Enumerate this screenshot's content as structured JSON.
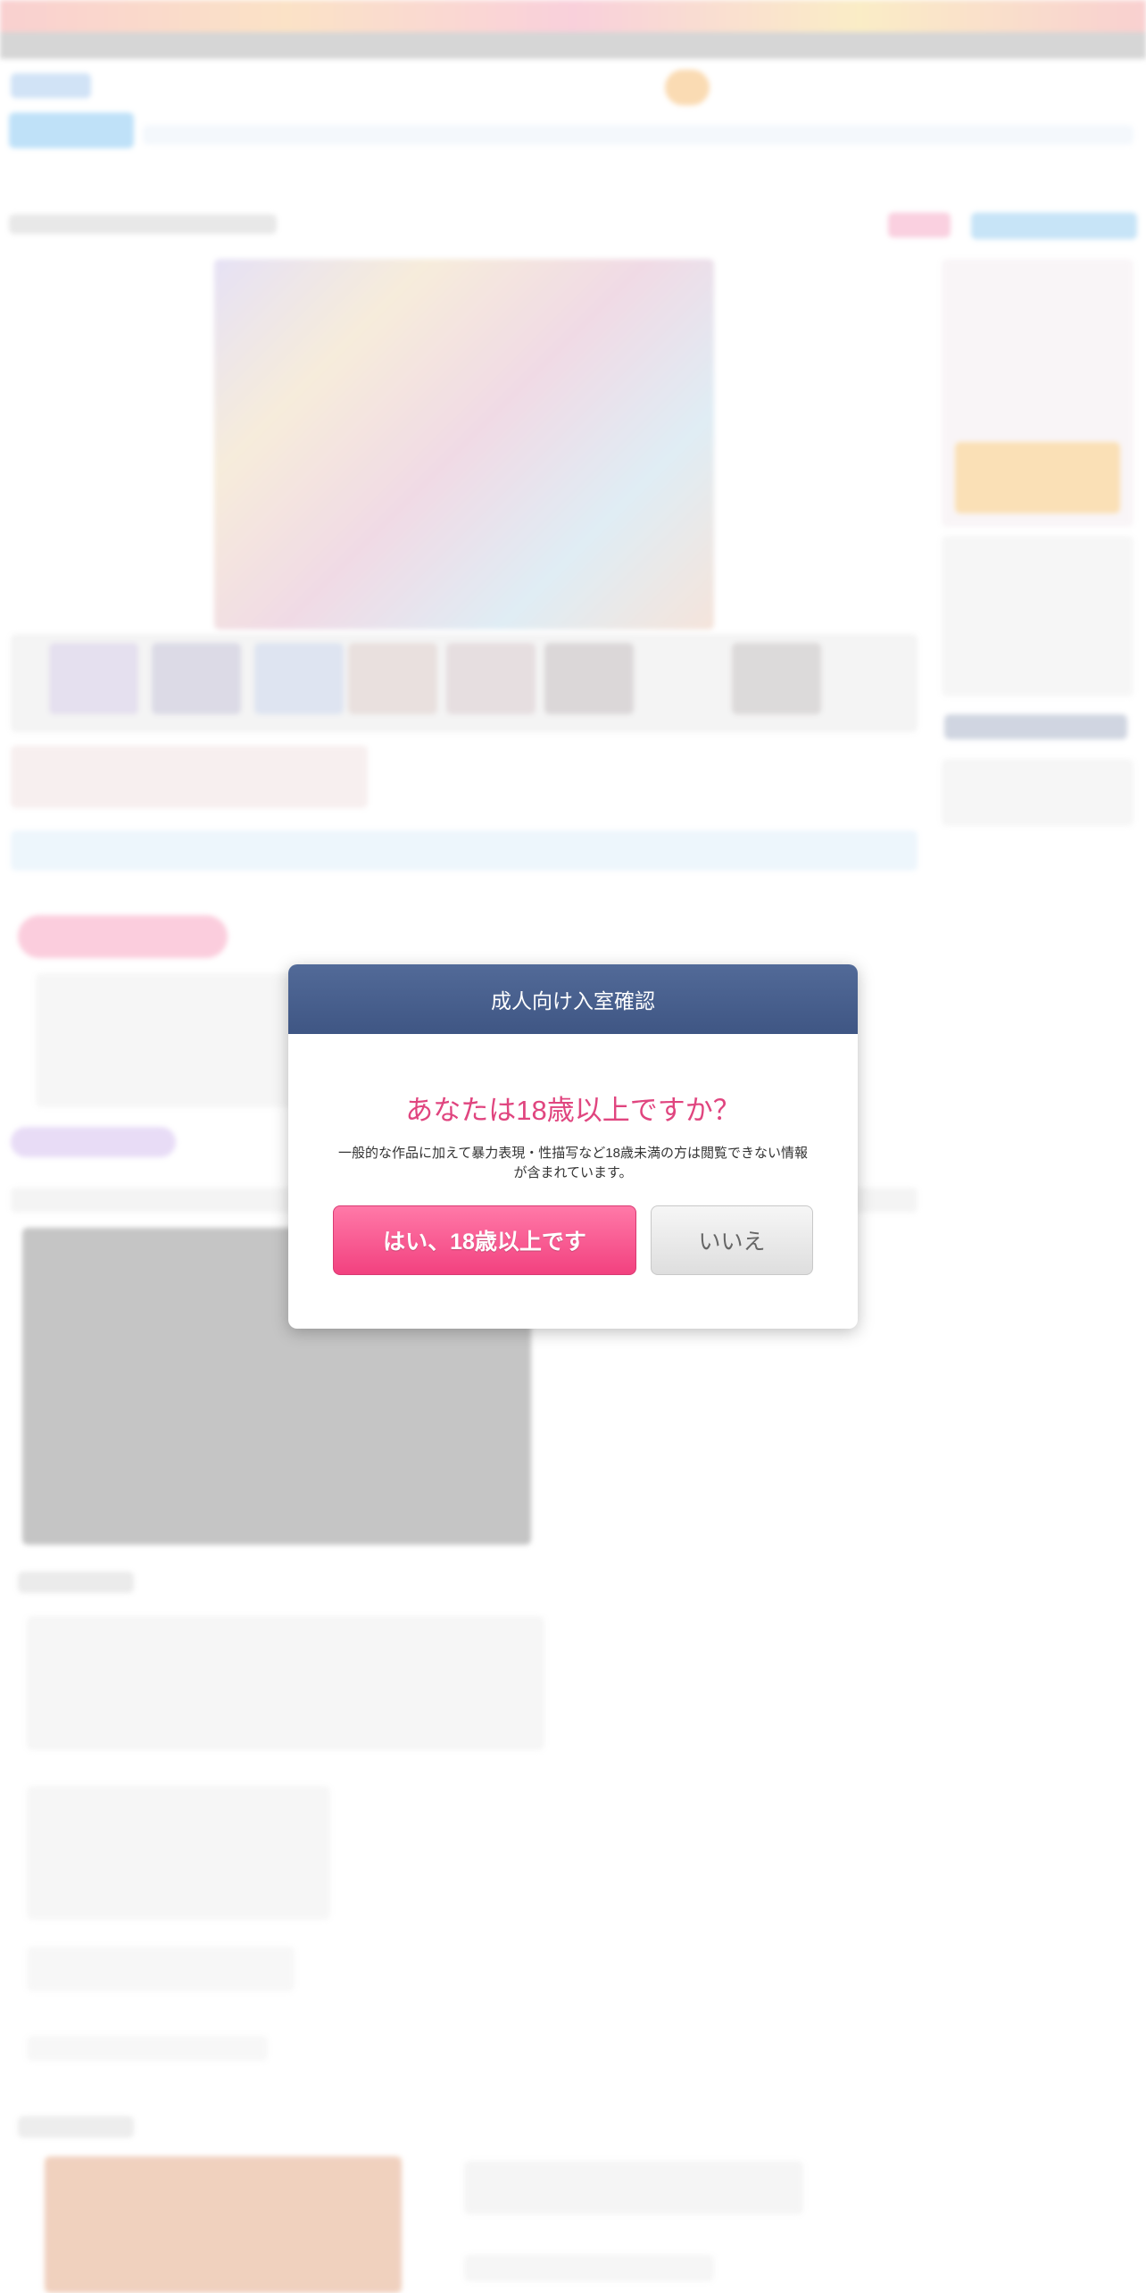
{
  "age_gate": {
    "title": "成人向け入室確認",
    "question": "あなたは18歳以上ですか？",
    "description": "一般的な作品に加えて暴力表現・性描写など18歳未満の方は閲覧できない情報が含まれています。",
    "yes_label": "はい、18歳以上です",
    "no_label": "いいえ"
  },
  "colors": {
    "header_bar": "#4a608f",
    "question_text": "#e0457f",
    "yes_button": "#f5508a",
    "no_button": "#e6e6e6"
  }
}
